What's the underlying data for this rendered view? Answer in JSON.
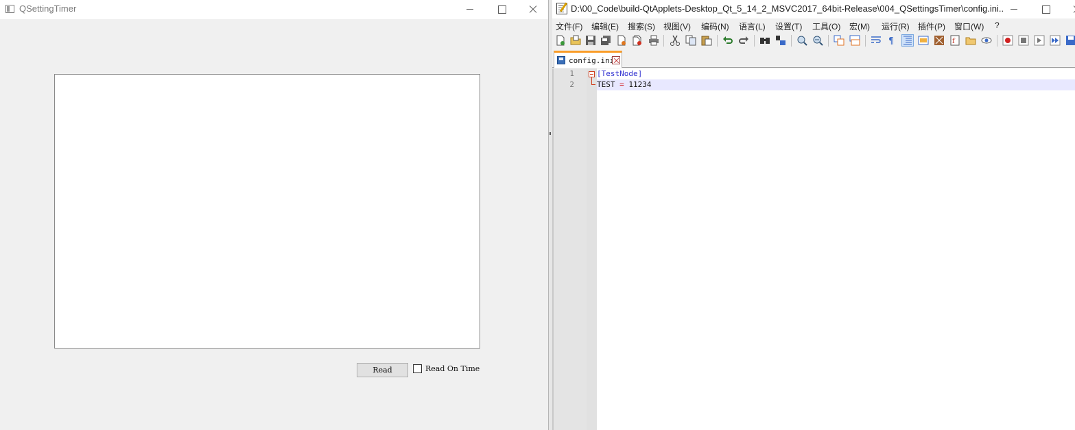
{
  "qt_window": {
    "title": "QSettingTimer",
    "text_area_value": "",
    "read_button_label": "Read",
    "checkbox_label": "Read On Time",
    "checkbox_checked": false
  },
  "npp_window": {
    "title": "D:\\00_Code\\build-QtApplets-Desktop_Qt_5_14_2_MSVC2017_64bit-Release\\004_QSettingsTimer\\config.ini...",
    "menu": [
      "文件(F)",
      "编辑(E)",
      "搜索(S)",
      "视图(V)",
      "编码(N)",
      "语言(L)",
      "设置(T)",
      "工具(O)",
      "宏(M)",
      "运行(R)",
      "插件(P)",
      "窗口(W)",
      "?"
    ],
    "toolbar_icons": [
      "new-file-icon",
      "open-file-icon",
      "save-icon",
      "save-all-icon",
      "close-icon",
      "close-all-icon",
      "print-icon",
      "cut-icon",
      "copy-icon",
      "paste-icon",
      "undo-icon",
      "redo-icon",
      "find-icon",
      "replace-icon",
      "zoom-in-icon",
      "zoom-out-icon",
      "sync-vertical-icon",
      "sync-horizontal-icon",
      "word-wrap-icon",
      "show-all-chars-icon",
      "indent-guide-icon",
      "user-lang-icon",
      "doc-map-icon",
      "function-list-icon",
      "folder-workspace-icon",
      "monitoring-icon",
      "record-macro-icon",
      "stop-record-icon",
      "play-macro-icon",
      "run-macro-multiple-icon",
      "save-macro-icon"
    ],
    "tab": {
      "label": "config.ini"
    },
    "lines": [
      {
        "number": "1",
        "tokens": [
          {
            "type": "section",
            "text": "[TestNode]"
          }
        ]
      },
      {
        "number": "2",
        "tokens": [
          {
            "type": "key",
            "text": "TEST "
          },
          {
            "type": "eq",
            "text": "="
          },
          {
            "type": "val",
            "text": " 11234"
          }
        ]
      }
    ],
    "colors": {
      "accent_tab": "#fa9c28",
      "section": "#3030d0",
      "operator": "#d01010",
      "current_line": "#e8e8ff"
    }
  }
}
